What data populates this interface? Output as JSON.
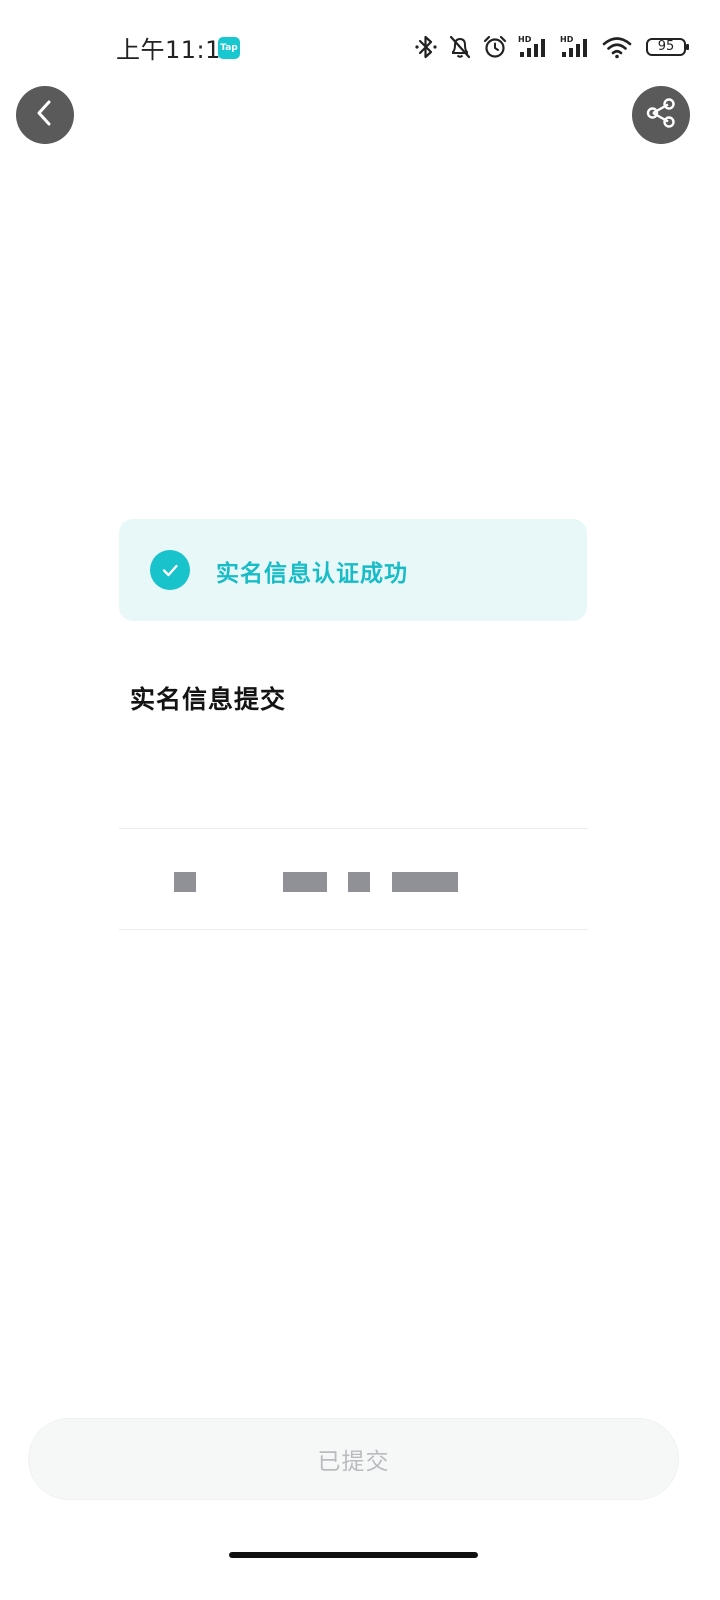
{
  "status_bar": {
    "time": "上午11:10",
    "app_badge": "Tap",
    "battery": "95",
    "icons": [
      "bluetooth-icon",
      "bell-muted-icon",
      "alarm-icon",
      "signal-hd-icon",
      "signal-hd-icon",
      "wifi-icon",
      "battery-icon"
    ]
  },
  "nav": {
    "back_icon": "chevron-left-icon",
    "share_icon": "share-icon"
  },
  "banner": {
    "text": "实名信息认证成功",
    "icon": "check-circle-icon",
    "accent_color": "#18c3cc"
  },
  "form": {
    "title": "实名信息提交"
  },
  "submit": {
    "label": "已提交"
  }
}
